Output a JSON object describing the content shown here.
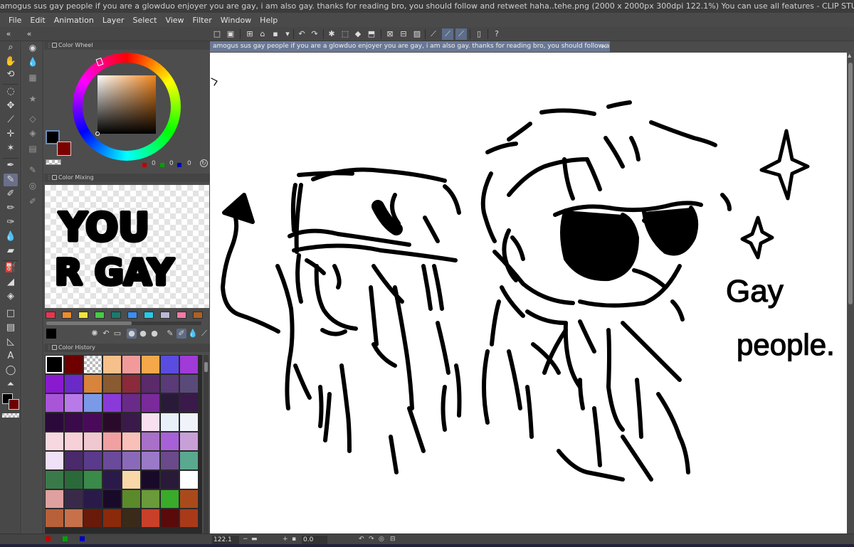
{
  "window": {
    "title": "amogus sus gay people if you are a glowduo enjoyer you are gay, i am also gay. thanks for reading bro, you should follow and retweet haha..tehe.png (2000 x 2000px 300dpi 122.1%)  You can use all features - CLIP STUDIO PAINT PRO"
  },
  "menu": [
    "File",
    "Edit",
    "Animation",
    "Layer",
    "Select",
    "View",
    "Filter",
    "Window",
    "Help"
  ],
  "document_tab": {
    "title": "amogus sus gay people if you are a glowduo enjoyer you are gay, i am also gay. thanks for reading bro, you should follow and retweet haha..tehe.png",
    "close": "×"
  },
  "panels": {
    "color_wheel": {
      "title": "Color Wheel",
      "r": "0",
      "g": "0",
      "b": "0",
      "main_color": "#000000",
      "sub_color": "#7b0000"
    },
    "color_mixing": {
      "title": "Color Mixing",
      "text_line1": "YOU",
      "text_line2": "R GAY"
    },
    "color_history": {
      "title": "Color History"
    }
  },
  "palette_colors": [
    "#e8344e",
    "#f28a2c",
    "#f2e43a",
    "#44cc44",
    "#1a7a6e",
    "#3a8ef0",
    "#27c9e8",
    "#b8b8d8",
    "#f07aa8",
    "#b06020"
  ],
  "history_colors": [
    "#000000",
    "#6e0000",
    "transparent",
    "#f5c08a",
    "#f29a9a",
    "#f5a84a",
    "#5a4ce0",
    "#a03ad8",
    "#8a1ad0",
    "#6a2ac8",
    "#d8843a",
    "#8a5a30",
    "#8a2a3a",
    "#5a2a6a",
    "#5a3a78",
    "#5a4a7a",
    "#a855d8",
    "#b87ae8",
    "#7a9ae8",
    "#8a3ad8",
    "#6a2a8a",
    "#7a2a9a",
    "#2a1a3a",
    "#3a1a4a",
    "#2a0a3a",
    "#3a0a4a",
    "#4a0a5a",
    "#2a0a2a",
    "#3a1a4a",
    "#f8e0f0",
    "#e8f0fa",
    "#f0f4fa",
    "#f8d8e0",
    "#f8d0d8",
    "#f0c8d0",
    "#f0a0a0",
    "#f8c0b8",
    "#a870c8",
    "#a860d8",
    "#c8a0d8",
    "#f0e0f8",
    "#4a2a6a",
    "#5a3a8a",
    "#6a4a9a",
    "#8a6ab8",
    "#9a7ac8",
    "#6a4a8a",
    "#5aa890",
    "#3a7a4a",
    "#2a6a3a",
    "#3a8a4a",
    "#2a1a4a",
    "#f8d8a8",
    "#1a0a2a",
    "#2a1a3a",
    "#ffffff",
    "#e0a0a0",
    "#3a2a4a",
    "#2a1a4a",
    "#1a0a2a",
    "#5a8a2a",
    "#6a9a3a",
    "#3aaa2a",
    "#aa4a1a",
    "#b8603a",
    "#c8704a",
    "#6a1a0a",
    "#8a2a0a",
    "#3a2a1a",
    "#c8402a",
    "#5a0a0a",
    "#a83a1a"
  ],
  "canvas": {
    "handwriting_line1": "Gay",
    "handwriting_line2": "people."
  },
  "status": {
    "zoom": "122.1",
    "rotation": "0.0"
  }
}
